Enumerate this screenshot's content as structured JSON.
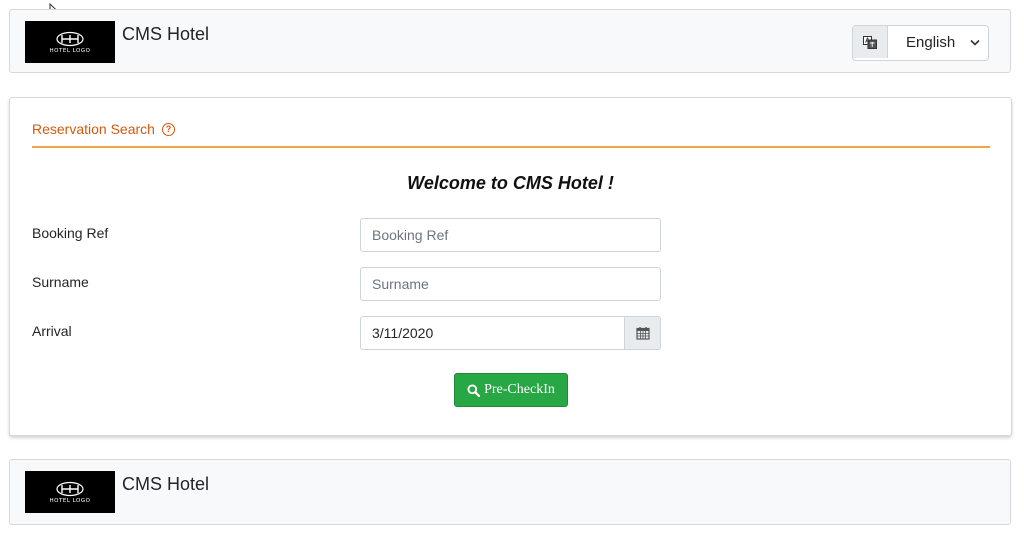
{
  "header": {
    "logo_text": "HOTEL LOGO",
    "brand": "CMS Hotel",
    "language": {
      "selected": "English",
      "icon": "translate-icon"
    }
  },
  "reservation": {
    "title": "Reservation Search",
    "help_icon": "question-circle-icon",
    "welcome": "Welcome to CMS Hotel !",
    "fields": {
      "booking_ref": {
        "label": "Booking Ref",
        "placeholder": "Booking Ref",
        "value": ""
      },
      "surname": {
        "label": "Surname",
        "placeholder": "Surname",
        "value": ""
      },
      "arrival": {
        "label": "Arrival",
        "value": "3/11/2020",
        "icon": "calendar-icon"
      }
    },
    "submit": {
      "label": "Pre-CheckIn",
      "icon": "search-icon"
    }
  },
  "footer": {
    "logo_text": "HOTEL LOGO",
    "brand": "CMS Hotel"
  },
  "colors": {
    "accent": "#d5580e",
    "rule": "#f5a04a",
    "button": "#28a745",
    "navbar_bg": "#f8f9fa"
  }
}
